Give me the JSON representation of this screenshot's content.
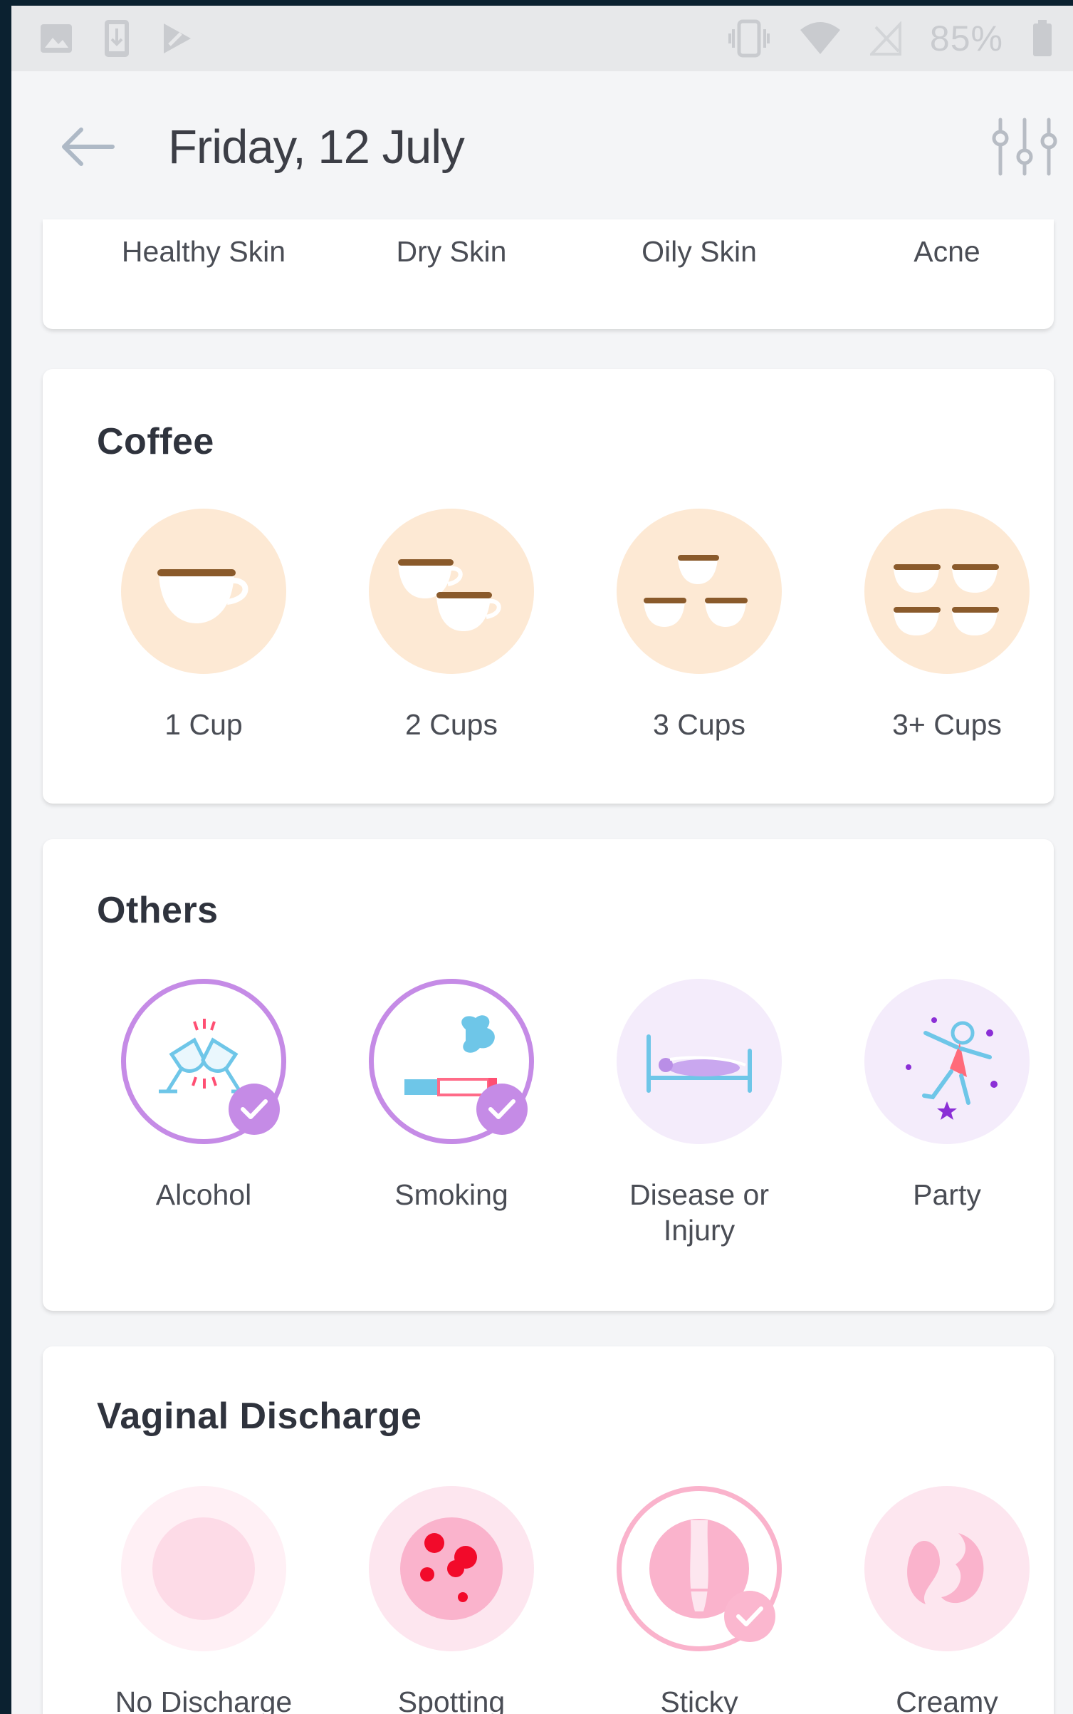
{
  "status_bar": {
    "battery": "85%"
  },
  "header": {
    "title": "Friday, 12 July"
  },
  "skin": {
    "items": [
      "Healthy Skin",
      "Dry Skin",
      "Oily Skin",
      "Acne"
    ]
  },
  "coffee": {
    "title": "Coffee",
    "items": [
      {
        "label": "1 Cup",
        "icon": "one-cup-icon"
      },
      {
        "label": "2 Cups",
        "icon": "two-cups-icon"
      },
      {
        "label": "3 Cups",
        "icon": "three-cups-icon"
      },
      {
        "label": "3+ Cups",
        "icon": "more-cups-icon"
      }
    ]
  },
  "others": {
    "title": "Others",
    "items": [
      {
        "label": "Alcohol",
        "icon": "wine-glasses-icon",
        "selected": true
      },
      {
        "label": "Smoking",
        "icon": "cigarette-icon",
        "selected": true
      },
      {
        "label": "Disease or Injury",
        "icon": "sick-bed-icon",
        "selected": false
      },
      {
        "label": "Party",
        "icon": "dancer-icon",
        "selected": false
      }
    ]
  },
  "discharge": {
    "title": "Vaginal Discharge",
    "items": [
      {
        "label": "No Discharge",
        "icon": "no-discharge-icon",
        "selected": false
      },
      {
        "label": "Spotting",
        "icon": "spotting-icon",
        "selected": false
      },
      {
        "label": "Sticky",
        "icon": "sticky-icon",
        "selected": true
      },
      {
        "label": "Creamy",
        "icon": "creamy-icon",
        "selected": false
      }
    ]
  },
  "colors": {
    "accent_purple": "#c58be6",
    "coffee_circle": "#fde9d4",
    "others_circle": "#f4ecfb",
    "discharge_circle": "#fde6ef"
  }
}
